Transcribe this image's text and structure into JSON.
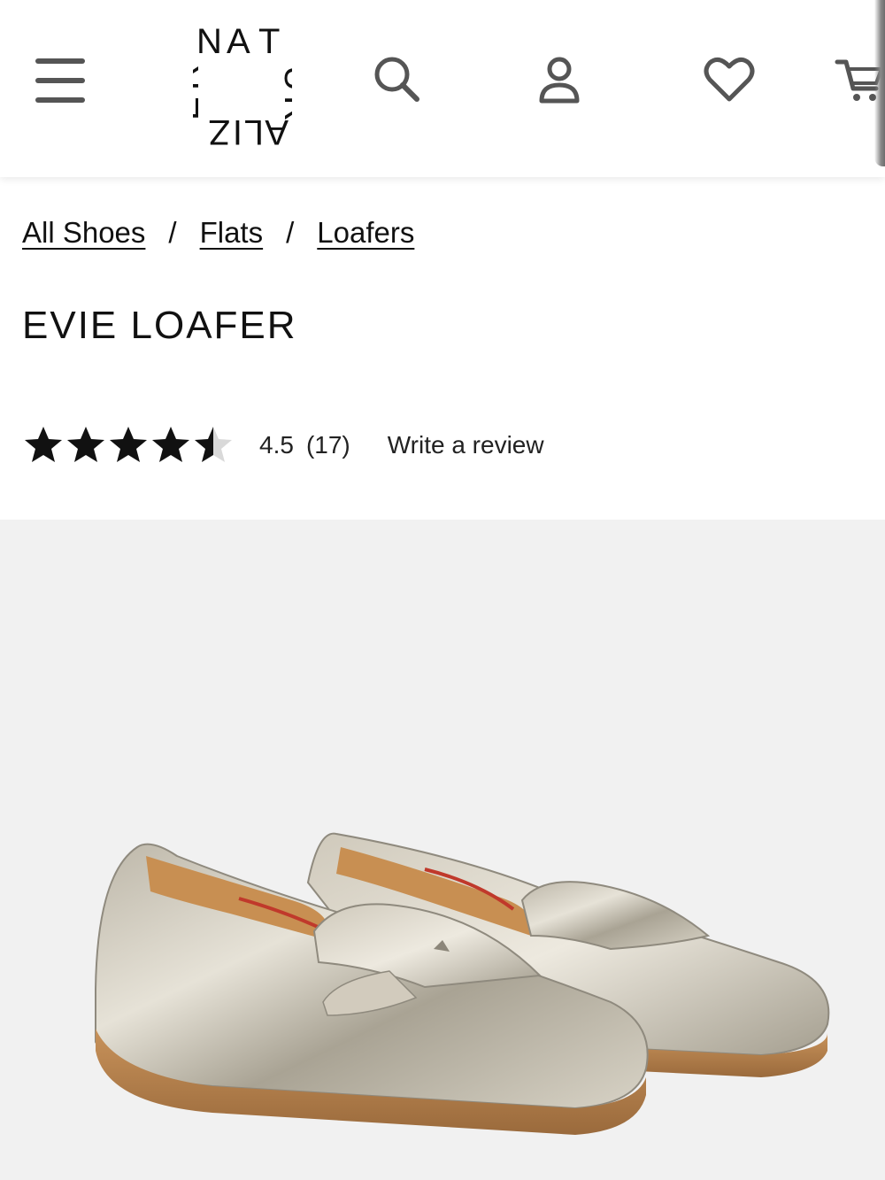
{
  "header": {
    "logo_text": "NATURALIZER",
    "icons": [
      "menu-icon",
      "search-icon",
      "account-icon",
      "heart-icon",
      "cart-icon"
    ]
  },
  "breadcrumb": {
    "items": [
      "All Shoes",
      "Flats",
      "Loafers"
    ],
    "separator": "/"
  },
  "product": {
    "title": "EVIE LOAFER",
    "rating": {
      "value": "4.5",
      "count": "(17)",
      "stars_filled": 4.5,
      "stars_total": 5
    },
    "write_review_label": "Write a review",
    "image_background": "#f1f1f1"
  },
  "colors": {
    "text": "#111111",
    "icon": "#555555",
    "star": "#111111"
  }
}
